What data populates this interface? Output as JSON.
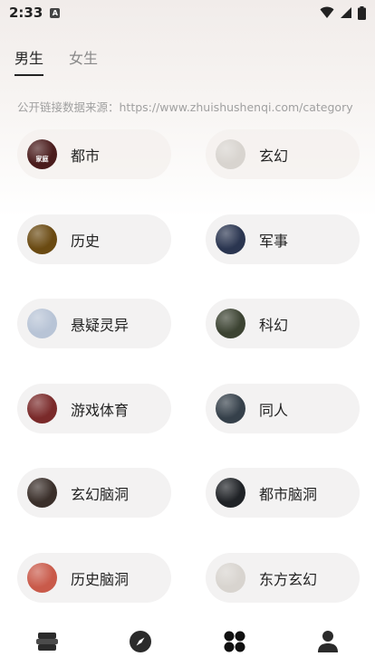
{
  "status": {
    "time": "2:33",
    "notif_letter": "A"
  },
  "tabs": [
    {
      "label": "男生",
      "active": true
    },
    {
      "label": "女生",
      "active": false
    }
  ],
  "source_text": "公开链接数据来源：https://www.zhuishushenqi.com/category",
  "categories": [
    {
      "label": "都市",
      "thumb_color": "#4a1c1c",
      "thumb_text": "家庭"
    },
    {
      "label": "玄幻",
      "thumb_color": "#d8d4cf",
      "thumb_text": ""
    },
    {
      "label": "历史",
      "thumb_color": "#6a4a12",
      "thumb_text": ""
    },
    {
      "label": "军事",
      "thumb_color": "#2a3550",
      "thumb_text": ""
    },
    {
      "label": "悬疑灵异",
      "thumb_color": "#b8c4d6",
      "thumb_text": ""
    },
    {
      "label": "科幻",
      "thumb_color": "#3c4332",
      "thumb_text": ""
    },
    {
      "label": "游戏体育",
      "thumb_color": "#7a2a2a",
      "thumb_text": ""
    },
    {
      "label": "同人",
      "thumb_color": "#35404a",
      "thumb_text": ""
    },
    {
      "label": "玄幻脑洞",
      "thumb_color": "#3a2f2a",
      "thumb_text": ""
    },
    {
      "label": "都市脑洞",
      "thumb_color": "#1f2226",
      "thumb_text": ""
    },
    {
      "label": "历史脑洞",
      "thumb_color": "#c95a4a",
      "thumb_text": ""
    },
    {
      "label": "东方玄幻",
      "thumb_color": "#d8d4cf",
      "thumb_text": ""
    }
  ],
  "nav": [
    {
      "icon": "bookshelf-icon"
    },
    {
      "icon": "compass-icon"
    },
    {
      "icon": "category-grid-icon",
      "active": true
    },
    {
      "icon": "profile-icon"
    }
  ],
  "colors": {
    "text_primary": "#222222",
    "text_muted": "#888888",
    "pill_bg": "#f3f2f2",
    "nav_icon": "#2b2b2b"
  }
}
